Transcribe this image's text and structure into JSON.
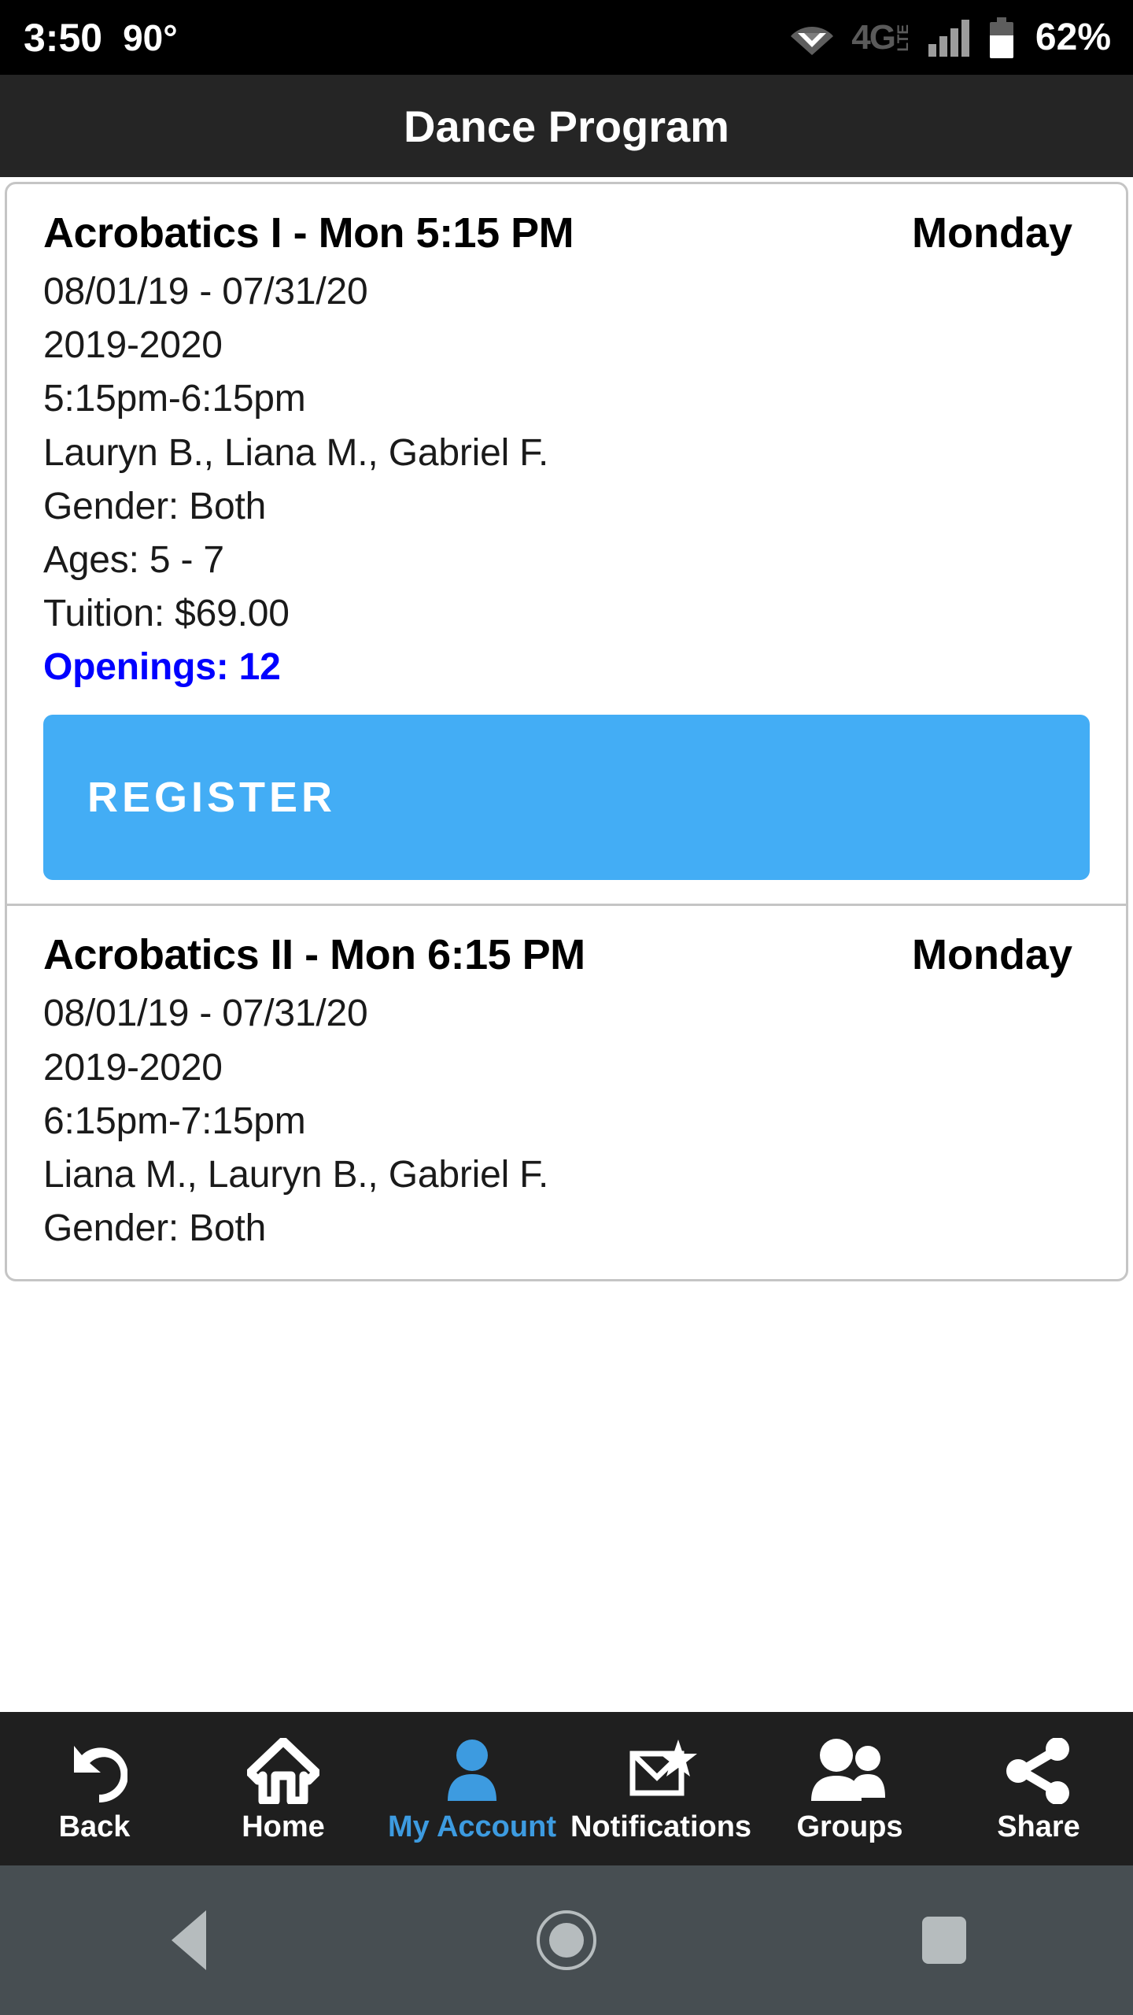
{
  "statusbar": {
    "clock": "3:50",
    "temperature": "90°",
    "network_label_4g": "4G",
    "network_label_lte": "LTE",
    "battery_percent": "62%",
    "icons": [
      "wifi-icon",
      "4g-lte-icon",
      "signal-bars-icon",
      "battery-icon"
    ]
  },
  "titlebar": {
    "title": "Dance Program"
  },
  "classes": [
    {
      "title": "Acrobatics I - Mon 5:15 PM",
      "day": "Monday",
      "date_range": "08/01/19 - 07/31/20",
      "season": "2019-2020",
      "time": "5:15pm-6:15pm",
      "instructors": "Lauryn B., Liana M., Gabriel F.",
      "gender": "Gender: Both",
      "ages": "Ages: 5 - 7",
      "tuition": "Tuition: $69.00",
      "openings": "Openings: 12",
      "register_label": "REGISTER"
    },
    {
      "title": "Acrobatics II - Mon 6:15 PM",
      "day": "Monday",
      "date_range": "08/01/19 - 07/31/20",
      "season": "2019-2020",
      "time": "6:15pm-7:15pm",
      "instructors": "Liana M., Lauryn B., Gabriel F.",
      "gender": "Gender: Both"
    }
  ],
  "appnav": {
    "items": [
      {
        "label": "Back",
        "icon": "undo-arrow-icon",
        "active": false
      },
      {
        "label": "Home",
        "icon": "house-icon",
        "active": false
      },
      {
        "label": "My Account",
        "icon": "person-icon",
        "active": true
      },
      {
        "label": "Notifications",
        "icon": "envelope-star-icon",
        "active": false
      },
      {
        "label": "Groups",
        "icon": "two-people-icon",
        "active": false
      },
      {
        "label": "Share",
        "icon": "share-nodes-icon",
        "active": false
      }
    ],
    "active_color": "#3d9be0"
  },
  "sysnav": {
    "back": "system-back-icon",
    "home": "system-home-icon",
    "recents": "system-recents-icon"
  },
  "colors": {
    "accent_blue": "#43adf5",
    "openings_blue": "#0000ff",
    "titlebar_bg": "#252525",
    "statusbar_bg": "#000000",
    "appnav_bg": "#1f1f1f",
    "sysnav_bg": "#474e52",
    "card_border": "#c5c5c5"
  }
}
